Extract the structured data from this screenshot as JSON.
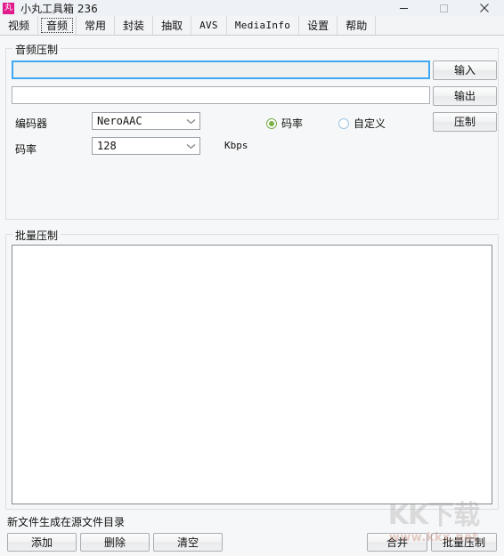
{
  "window": {
    "icon_glyph": "丸",
    "title": "小丸工具箱 236",
    "controls": {
      "minimize": "minimize-icon",
      "maximize": "maximize-icon",
      "close": "close-icon"
    }
  },
  "tabs": [
    {
      "label": "视频",
      "mono": false,
      "selected": false
    },
    {
      "label": "音频",
      "mono": false,
      "selected": true
    },
    {
      "label": "常用",
      "mono": false,
      "selected": false
    },
    {
      "label": "封装",
      "mono": false,
      "selected": false
    },
    {
      "label": "抽取",
      "mono": false,
      "selected": false
    },
    {
      "label": "AVS",
      "mono": true,
      "selected": false
    },
    {
      "label": "MediaInfo",
      "mono": true,
      "selected": false
    },
    {
      "label": "设置",
      "mono": false,
      "selected": false
    },
    {
      "label": "帮助",
      "mono": false,
      "selected": false
    }
  ],
  "audio_group": {
    "title": "音频压制",
    "input_path": {
      "value": "",
      "placeholder": ""
    },
    "output_path": {
      "value": "",
      "placeholder": ""
    },
    "input_button": "输入",
    "output_button": "输出",
    "encode_button": "压制",
    "encoder_label": "编码器",
    "encoder_value": "NeroAAC",
    "bitrate_label": "码率",
    "bitrate_value": "128",
    "kbps_label": "Kbps",
    "mode_bitrate": "码率",
    "mode_custom": "自定义",
    "selected_mode": "码率"
  },
  "batch_group": {
    "title": "批量压制",
    "list_items": [],
    "note": "新文件生成在源文件目录",
    "add_button": "添加",
    "delete_button": "删除",
    "clear_button": "清空",
    "merge_button": "合并",
    "batch_button": "批量压制"
  },
  "watermark": {
    "main": "KK下载",
    "sub": "www.kkx.net"
  },
  "colors": {
    "accent_focus": "#3fa9f5",
    "radio_on": "#7bb042",
    "app_icon": "#e21b8d",
    "window_bg": "#f6f7f8"
  }
}
